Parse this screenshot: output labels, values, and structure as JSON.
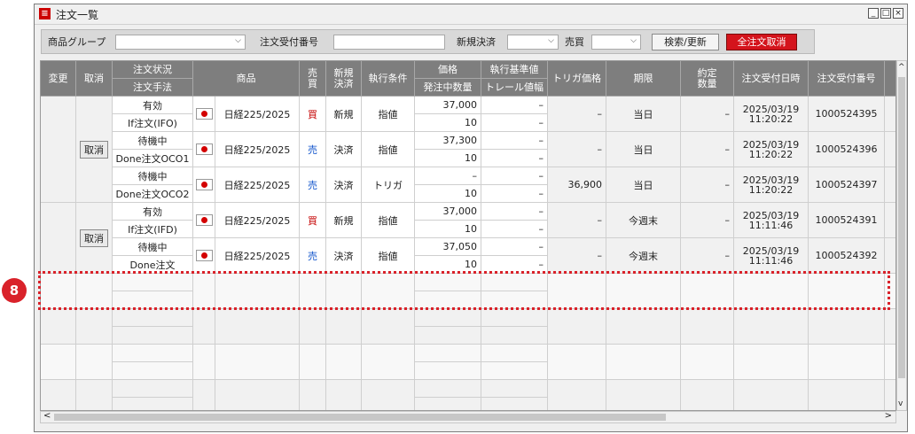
{
  "window": {
    "title": "注文一覧",
    "controls": [
      "_",
      "□",
      "×"
    ]
  },
  "toolbar": {
    "product_group_label": "商品グループ",
    "product_group_value": "",
    "order_no_label": "注文受付番号",
    "order_no_value": "",
    "new_settle_label": "新規決済",
    "new_settle_value": "",
    "buysell_label": "売買",
    "buysell_value": "",
    "search_btn": "検索/更新",
    "cancel_all_btn": "全注文取消"
  },
  "headers": {
    "change": "変更",
    "cancel": "取消",
    "status": "注文状況",
    "method": "注文手法",
    "product": "商品",
    "buysell": "売買",
    "newsettle": "新規決済",
    "condition": "執行条件",
    "price": "価格",
    "qty": "発注中数量",
    "basis": "執行基準値",
    "trail": "トレール値幅",
    "trigger": "トリガ価格",
    "term": "期限",
    "filled": "約定数量",
    "datetime": "注文受付日時",
    "orderno": "注文受付番号"
  },
  "groups": [
    {
      "cancel": "取消"
    },
    {
      "cancel": "取消"
    }
  ],
  "orders": [
    {
      "status": "有効",
      "method": "If注文(IFO)",
      "product": "日経225/2025",
      "buysell": "買",
      "side": "buy",
      "newsettle": "新規",
      "condition": "指値",
      "price": "37,000",
      "qty": "10",
      "basis": "–",
      "trail": "–",
      "trigger": "–",
      "term": "当日",
      "filled": "–",
      "date": "2025/03/19",
      "time": "11:20:22",
      "orderno": "1000524395"
    },
    {
      "status": "待機中",
      "method": "Done注文OCO1",
      "product": "日経225/2025",
      "buysell": "売",
      "side": "sell",
      "newsettle": "決済",
      "condition": "指値",
      "price": "37,300",
      "qty": "10",
      "basis": "–",
      "trail": "–",
      "trigger": "–",
      "term": "当日",
      "filled": "–",
      "date": "2025/03/19",
      "time": "11:20:22",
      "orderno": "1000524396"
    },
    {
      "status": "待機中",
      "method": "Done注文OCO2",
      "product": "日経225/2025",
      "buysell": "売",
      "side": "sell",
      "newsettle": "決済",
      "condition": "トリガ",
      "price": "–",
      "qty": "10",
      "basis": "–",
      "trail": "–",
      "trigger": "36,900",
      "term": "当日",
      "filled": "–",
      "date": "2025/03/19",
      "time": "11:20:22",
      "orderno": "1000524397"
    },
    {
      "status": "有効",
      "method": "If注文(IFD)",
      "product": "日経225/2025",
      "buysell": "買",
      "side": "buy",
      "newsettle": "新規",
      "condition": "指値",
      "price": "37,000",
      "qty": "10",
      "basis": "–",
      "trail": "–",
      "trigger": "–",
      "term": "今週末",
      "filled": "–",
      "date": "2025/03/19",
      "time": "11:11:46",
      "orderno": "1000524391"
    },
    {
      "status": "待機中",
      "method": "Done注文",
      "product": "日経225/2025",
      "buysell": "売",
      "side": "sell",
      "newsettle": "決済",
      "condition": "指値",
      "price": "37,050",
      "qty": "10",
      "basis": "–",
      "trail": "–",
      "trigger": "–",
      "term": "今週末",
      "filled": "–",
      "date": "2025/03/19",
      "time": "11:11:46",
      "orderno": "1000524392"
    }
  ],
  "annotation": {
    "badge": "8"
  },
  "scroll": {
    "up": "^",
    "down": "v",
    "left": "<",
    "right": ">"
  },
  "colors": {
    "header": "#7e7e7e",
    "buy": "#c40000",
    "sell": "#1155cc",
    "cancel_all": "#d4141c",
    "highlight": "#d9222a"
  }
}
